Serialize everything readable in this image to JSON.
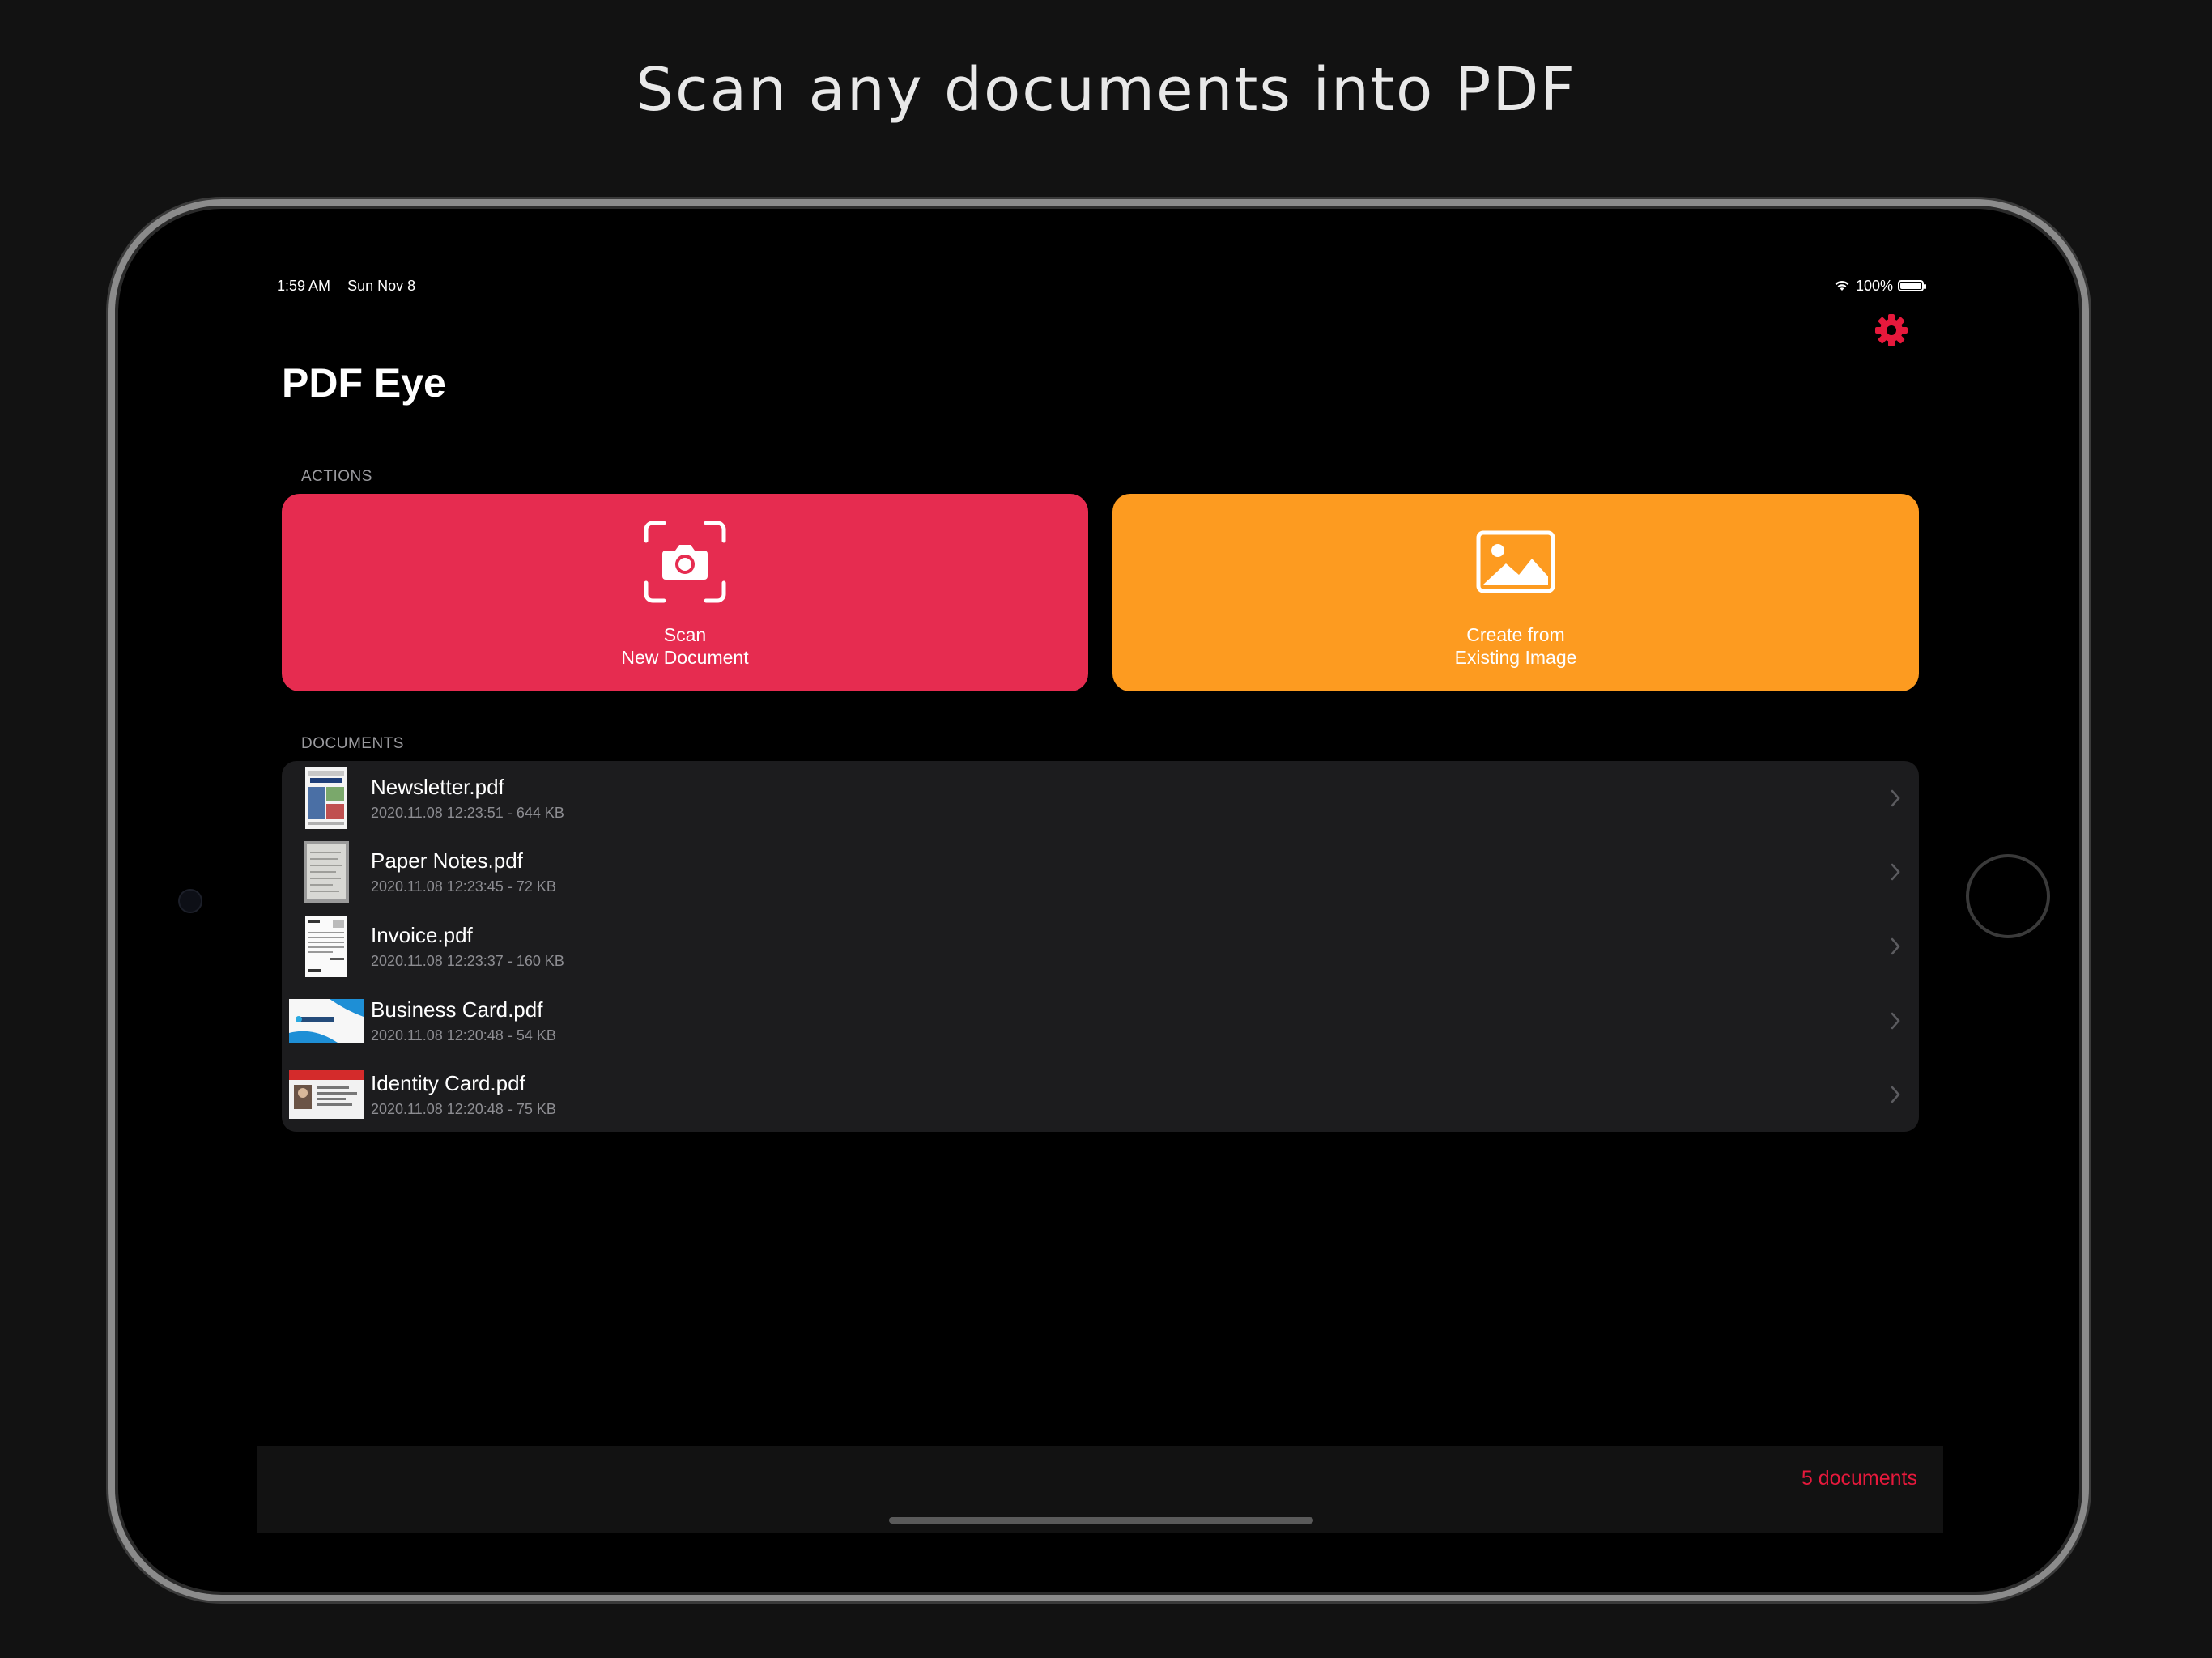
{
  "headline": "Scan any documents into PDF",
  "status_bar": {
    "time": "1:59 AM",
    "date": "Sun Nov 8",
    "battery": "100%",
    "wifi_icon": "wifi-icon",
    "battery_icon": "battery-icon"
  },
  "header": {
    "title": "PDF Eye",
    "settings_icon": "gear-icon"
  },
  "actions": {
    "section_label": "ACTIONS",
    "scan": {
      "line1": "Scan",
      "line2": "New Document",
      "icon": "camera-scan-icon",
      "color": "#e62c50"
    },
    "create": {
      "line1": "Create from",
      "line2": "Existing Image",
      "icon": "image-icon",
      "color": "#fd9b20"
    }
  },
  "documents": {
    "section_label": "DOCUMENTS",
    "items": [
      {
        "name": "Newsletter.pdf",
        "meta": "2020.11.08 12:23:51 - 644 KB",
        "thumb": "newsletter-thumbnail"
      },
      {
        "name": "Paper Notes.pdf",
        "meta": "2020.11.08 12:23:45 - 72 KB",
        "thumb": "paper-notes-thumbnail"
      },
      {
        "name": "Invoice.pdf",
        "meta": "2020.11.08 12:23:37 - 160 KB",
        "thumb": "invoice-thumbnail"
      },
      {
        "name": "Business Card.pdf",
        "meta": "2020.11.08 12:20:48 - 54 KB",
        "thumb": "business-card-thumbnail"
      },
      {
        "name": "Identity Card.pdf",
        "meta": "2020.11.08 12:20:48 - 75 KB",
        "thumb": "identity-card-thumbnail"
      }
    ]
  },
  "footer": {
    "count": "5 documents",
    "accent_color": "#e6193c"
  }
}
